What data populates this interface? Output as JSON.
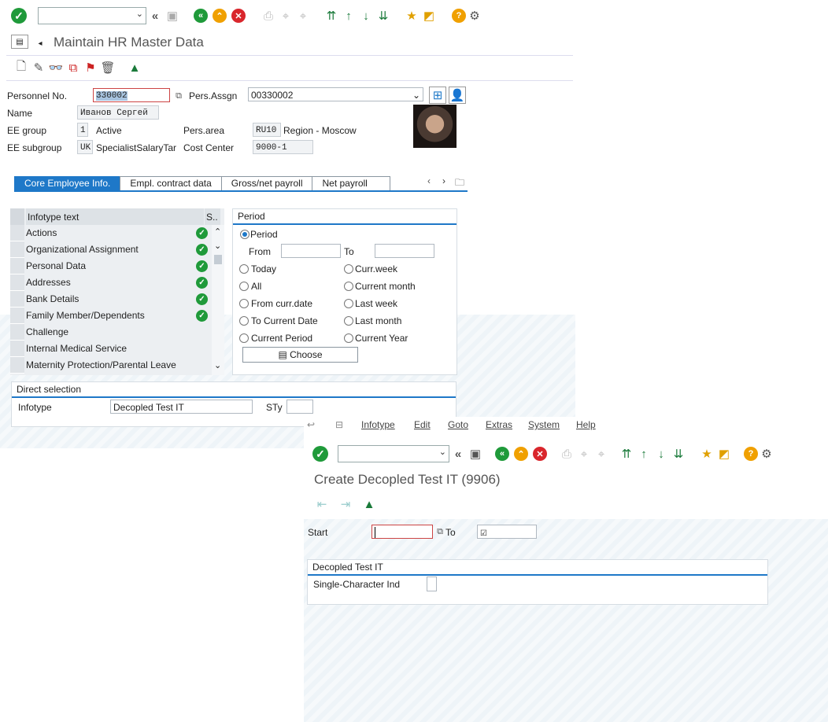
{
  "w1": {
    "title": "Maintain HR Master Data",
    "fields": {
      "personnel_no_label": "Personnel No.",
      "personnel_no": "330002",
      "pers_assgn_label": "Pers.Assgn",
      "pers_assgn": "00330002",
      "name_label": "Name",
      "name": "Иванов Сергей",
      "ee_group_label": "EE group",
      "ee_group": "1",
      "ee_group_text": "Active",
      "pers_area_label": "Pers.area",
      "pers_area": "RU10",
      "pers_area_text": "Region - Moscow",
      "ee_subgroup_label": "EE subgroup",
      "ee_subgroup": "UK",
      "ee_subgroup_text": "SpecialistSalaryTar",
      "cost_center_label": "Cost Center",
      "cost_center": "9000-1"
    },
    "tabs": [
      "Core Employee Info.",
      "Empl. contract data",
      "Gross/net payroll",
      "Net payroll"
    ],
    "infotype_table": {
      "col_text": "Infotype text",
      "col_status": "S..",
      "rows": [
        {
          "text": "Actions",
          "check": true
        },
        {
          "text": "Organizational Assignment",
          "check": true
        },
        {
          "text": "Personal Data",
          "check": true
        },
        {
          "text": "Addresses",
          "check": true
        },
        {
          "text": "Bank Details",
          "check": true
        },
        {
          "text": "Family Member/Dependents",
          "check": true
        },
        {
          "text": "Challenge",
          "check": false
        },
        {
          "text": "Internal Medical Service",
          "check": false
        },
        {
          "text": "Maternity Protection/Parental Leave",
          "check": false
        }
      ]
    },
    "period": {
      "header": "Period",
      "period_label": "Period",
      "from_label": "From",
      "to_label": "To",
      "opts_left": [
        "Today",
        "All",
        "From curr.date",
        "To Current Date",
        "Current Period"
      ],
      "opts_right": [
        "Curr.week",
        "Current month",
        "Last week",
        "Last month",
        "Current Year"
      ],
      "choose": "Choose"
    },
    "direct": {
      "header": "Direct selection",
      "infotype_label": "Infotype",
      "infotype_value": "Decopled Test IT",
      "sty_label": "STy"
    }
  },
  "w2": {
    "menu": [
      "Infotype",
      "Edit",
      "Goto",
      "Extras",
      "System",
      "Help"
    ],
    "title": "Create Decopled Test IT (9906)",
    "start_label": "Start",
    "to_label": "To",
    "group_header": "Decopled Test IT",
    "single_char_label": "Single-Character Ind"
  },
  "colors": {
    "accent": "#1e78c8",
    "ok_green": "#1f9a3a",
    "cancel_red": "#d9262c",
    "warn_orange": "#f0a000"
  }
}
